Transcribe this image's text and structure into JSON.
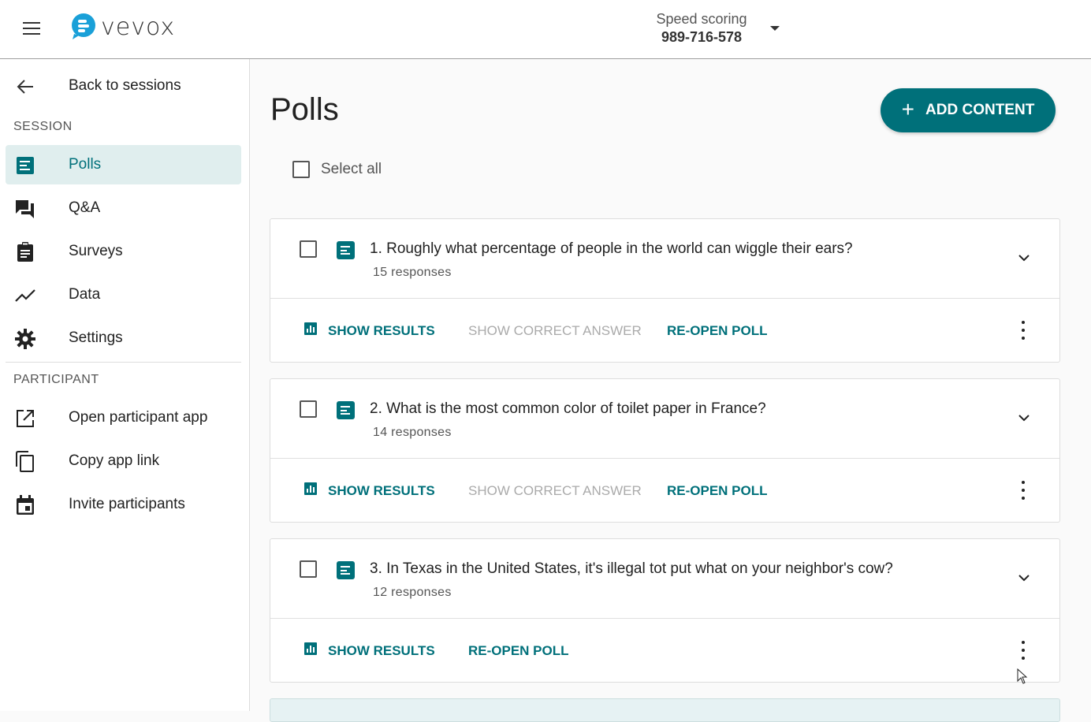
{
  "header": {
    "logo_text": "vevox",
    "session_name": "Speed scoring",
    "session_code": "989-716-578"
  },
  "sidebar": {
    "back_label": "Back to sessions",
    "session_section": "SESSION",
    "session_items": [
      {
        "label": "Polls",
        "icon": "polls-icon",
        "active": true
      },
      {
        "label": "Q&A",
        "icon": "qa-icon"
      },
      {
        "label": "Surveys",
        "icon": "surveys-icon"
      },
      {
        "label": "Data",
        "icon": "data-icon"
      },
      {
        "label": "Settings",
        "icon": "gear-icon"
      }
    ],
    "participant_section": "PARTICIPANT",
    "participant_items": [
      {
        "label": "Open participant app",
        "icon": "open-external-icon"
      },
      {
        "label": "Copy app link",
        "icon": "copy-icon"
      },
      {
        "label": "Invite participants",
        "icon": "calendar-icon"
      }
    ]
  },
  "main": {
    "title": "Polls",
    "add_content_label": "ADD CONTENT",
    "select_all_label": "Select all",
    "polls": [
      {
        "question": "1. Roughly what percentage of people in the world can wiggle their ears?",
        "responses": "15 responses",
        "actions": {
          "show_results": "SHOW RESULTS",
          "show_correct": "SHOW CORRECT ANSWER",
          "reopen": "RE-OPEN POLL"
        }
      },
      {
        "question": "2. What is the most common color of toilet paper in France?",
        "responses": "14 responses",
        "actions": {
          "show_results": "SHOW RESULTS",
          "show_correct": "SHOW CORRECT ANSWER",
          "reopen": "RE-OPEN POLL"
        }
      },
      {
        "question": "3. In Texas in the United States, it's illegal tot put what on your neighbor's cow?",
        "responses": "12 responses",
        "actions": {
          "show_results": "SHOW RESULTS",
          "reopen": "RE-OPEN POLL"
        }
      }
    ]
  },
  "colors": {
    "accent": "#00707a",
    "active_bg": "#e0eeee",
    "disabled_text": "#aaaaaa"
  }
}
